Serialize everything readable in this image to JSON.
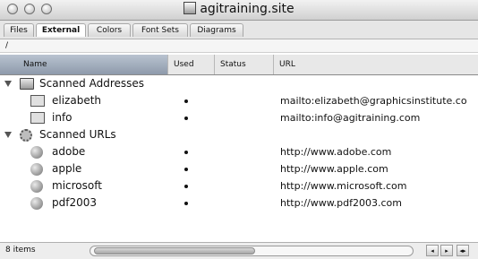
{
  "window": {
    "title": "agitraining.site",
    "title_icon": "site-document-icon"
  },
  "tabs": [
    {
      "label": "Files"
    },
    {
      "label": "External",
      "active": true
    },
    {
      "label": "Colors"
    },
    {
      "label": "Font Sets"
    },
    {
      "label": "Diagrams"
    }
  ],
  "path": "/",
  "columns": {
    "name": "Name",
    "used": "Used",
    "status": "Status",
    "url": "URL"
  },
  "groups": [
    {
      "label": "Scanned Addresses",
      "icon": "folder-icon",
      "items": [
        {
          "name": "elizabeth",
          "used": true,
          "url": "mailto:elizabeth@graphicsinstitute.co",
          "icon": "email-icon"
        },
        {
          "name": "info",
          "used": true,
          "url": "mailto:info@agitraining.com",
          "icon": "email-icon"
        }
      ]
    },
    {
      "label": "Scanned URLs",
      "icon": "gear-icon",
      "items": [
        {
          "name": "adobe",
          "used": true,
          "url": "http://www.adobe.com",
          "icon": "web-link-icon"
        },
        {
          "name": "apple",
          "used": true,
          "url": "http://www.apple.com",
          "icon": "web-link-icon"
        },
        {
          "name": "microsoft",
          "used": true,
          "url": "http://www.microsoft.com",
          "icon": "web-link-icon"
        },
        {
          "name": "pdf2003",
          "used": true,
          "url": "http://www.pdf2003.com",
          "icon": "web-link-icon"
        }
      ]
    }
  ],
  "status": {
    "item_count": "8 items"
  },
  "scroll_arrows": {
    "left": "◂",
    "right": "▸",
    "split": "◂▸"
  }
}
